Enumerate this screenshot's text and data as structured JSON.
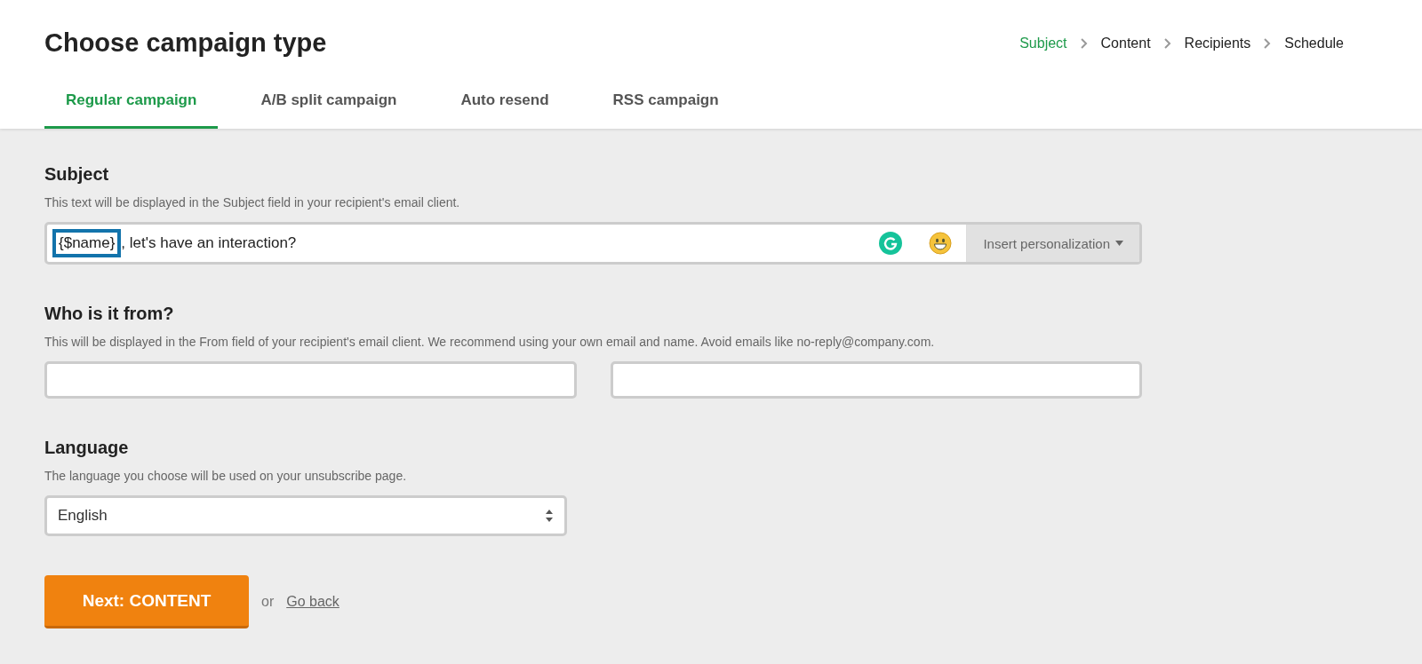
{
  "title": "Choose campaign type",
  "steps": [
    {
      "label": "Subject",
      "selected": true
    },
    {
      "label": "Content",
      "selected": false
    },
    {
      "label": "Recipients",
      "selected": false
    },
    {
      "label": "Schedule",
      "selected": false
    }
  ],
  "tabs": [
    {
      "label": "Regular campaign",
      "selected": true
    },
    {
      "label": "A/B split campaign",
      "selected": false
    },
    {
      "label": "Auto resend",
      "selected": false
    },
    {
      "label": "RSS campaign",
      "selected": false
    }
  ],
  "subject": {
    "heading": "Subject",
    "hint": "This text will be displayed in the Subject field in your recipient's email client.",
    "token": "{$name}",
    "value": ", let's have an interaction?",
    "personalization": "Insert personalization"
  },
  "from": {
    "heading": "Who is it from?",
    "hint": "This will be displayed in the From field of your recipient's email client. We recommend using your own email and name. Avoid emails like no-reply@company.com."
  },
  "language": {
    "heading": "Language",
    "hint": "The language you choose will be used on your unsubscribe page.",
    "value": "English"
  },
  "next_button": "Next: CONTENT",
  "or": "or",
  "back_link": "Go back"
}
